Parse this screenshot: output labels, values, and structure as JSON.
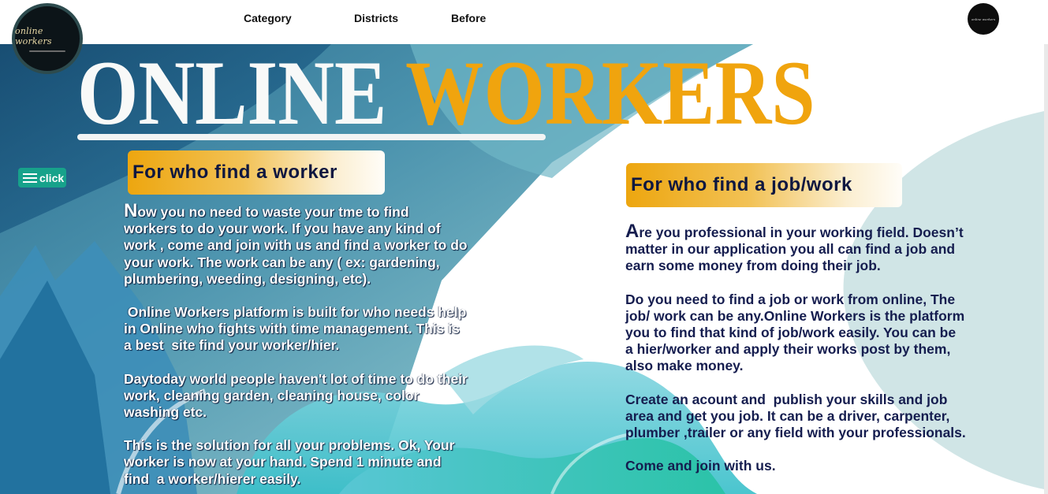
{
  "nav": {
    "links": [
      "Category",
      "Districts",
      "Before"
    ],
    "logo_text": "online workers",
    "logo_small_text": "online workers"
  },
  "hero": {
    "title_word1": "ONLINE",
    "title_word2": "WORKERS",
    "menu_button": "click",
    "colors": {
      "title_accent": "#f0a40e",
      "button": "#17a28b",
      "heading_text": "#0e1740"
    }
  },
  "left": {
    "heading": "For who find a worker",
    "paragraphs": [
      {
        "lines": [
          {
            "cap": "N",
            "text": "ow you no need to waste your tme to find"
          },
          {
            "text": "workers to do your work. If you have any kind of"
          },
          {
            "text": "work , come and join with us and find a worker to do"
          },
          {
            "text": "your work. The work can be any ( ex: gardening,"
          },
          {
            "text": "plumbering, weeding, designing, etc)."
          }
        ]
      },
      {
        "lines": [
          {
            "text": " Online Workers platform is built for who needs help"
          },
          {
            "text": "in Online who fights with time management. This is"
          },
          {
            "text": "a best  site find your worker/hier."
          }
        ]
      },
      {
        "lines": [
          {
            "text": "Daytoday world people haven't lot of time to do their"
          },
          {
            "text": "work, cleaning garden, cleaning house, color"
          },
          {
            "text": "washing etc."
          }
        ]
      },
      {
        "lines": [
          {
            "text": "This is the solution for all your problems. Ok, Your"
          },
          {
            "text": "worker is now at your hand. Spend 1 minute and"
          },
          {
            "text": "find  a worker/hierer easily."
          }
        ]
      }
    ]
  },
  "right": {
    "heading": "For who find a job/work",
    "paragraphs": [
      {
        "lines": [
          {
            "cap": "A",
            "text": "re you professional in your working field. Doesn’t"
          },
          {
            "text": "matter in our application you all can find a job and"
          },
          {
            "text": "earn some money from doing their job."
          }
        ]
      },
      {
        "lines": [
          {
            "text": "Do you need to find a job or work from online, The"
          },
          {
            "text": "job/ work can be any.Online Workers is the platform"
          },
          {
            "text": "you to find that kind of job/work easily. You can be"
          },
          {
            "text": "a hier/worker and apply their works post by them,"
          },
          {
            "text": "also make money."
          }
        ]
      },
      {
        "lines": [
          {
            "text": "Create an acount and  publish your skills and job"
          },
          {
            "text": "area and get you job. It can be a driver, carpenter,"
          },
          {
            "text": "plumber ,trailer or any field with your professionals."
          }
        ]
      },
      {
        "lines": [
          {
            "text": "Come and join with us."
          }
        ]
      }
    ]
  }
}
